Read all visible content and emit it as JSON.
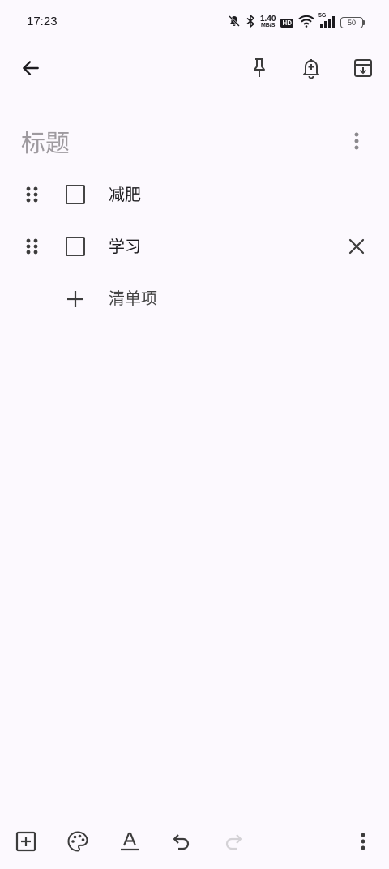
{
  "status_bar": {
    "time": "17:23",
    "net_speed_value": "1.40",
    "net_speed_unit": "MB/S",
    "hd_badge": "HD",
    "network_type": "5G",
    "battery_level": "50"
  },
  "toolbar": {
    "back_icon": "arrow-left-icon",
    "pin_icon": "pin-icon",
    "reminder_icon": "bell-plus-icon",
    "archive_icon": "archive-icon"
  },
  "note": {
    "title_placeholder": "标题",
    "title_value": "",
    "items": [
      {
        "text": "减肥",
        "checked": false
      },
      {
        "text": "学习",
        "checked": false
      }
    ],
    "add_item_label": "清单项"
  },
  "bottom_bar": {
    "icons": [
      "add-box-icon",
      "palette-icon",
      "text-format-icon",
      "undo-icon",
      "redo-icon",
      "more-vert-icon"
    ]
  },
  "colors": {
    "background": "#fcf9fe",
    "icon": "#3c3c3c",
    "placeholder": "#9e9a9f",
    "disabled": "#d4d2d6"
  }
}
